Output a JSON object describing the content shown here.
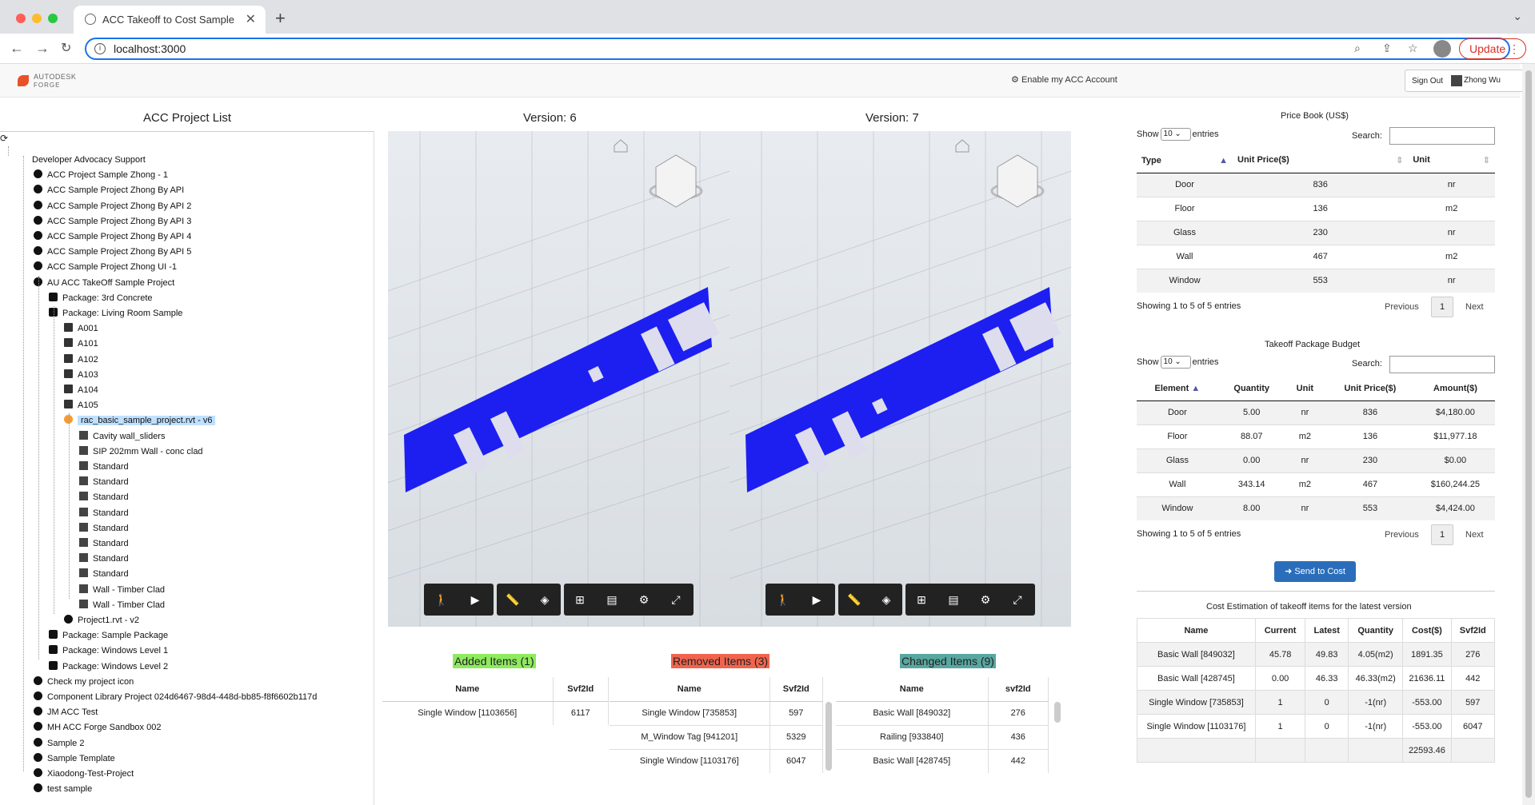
{
  "browser": {
    "tab_title": "ACC Takeoff to Cost Sample",
    "url": "localhost:3000",
    "update_label": "Update"
  },
  "header": {
    "logo_line1": "AUTODESK",
    "logo_line2": "FORGE",
    "enable_link": "Enable my ACC Account",
    "signout": "Sign Out",
    "user": "Zhong Wu"
  },
  "project_list": {
    "title": "ACC Project List",
    "items": [
      {
        "label": "Developer Advocacy Support",
        "level": 0,
        "icon": "none"
      },
      {
        "label": "ACC Project Sample Zhong - 1",
        "level": 1,
        "icon": "globe"
      },
      {
        "label": "ACC Sample Project Zhong By API",
        "level": 1,
        "icon": "globe"
      },
      {
        "label": "ACC Sample Project Zhong By API 2",
        "level": 1,
        "icon": "globe"
      },
      {
        "label": "ACC Sample Project Zhong By API 3",
        "level": 1,
        "icon": "globe"
      },
      {
        "label": "ACC Sample Project Zhong By API 4",
        "level": 1,
        "icon": "globe"
      },
      {
        "label": "ACC Sample Project Zhong By API 5",
        "level": 1,
        "icon": "globe"
      },
      {
        "label": "ACC Sample Project Zhong UI -1",
        "level": 1,
        "icon": "globe"
      },
      {
        "label": "AU ACC TakeOff Sample Project",
        "level": 1,
        "icon": "globe"
      },
      {
        "label": "Package: 3rd Concrete",
        "level": 2,
        "icon": "briefcase"
      },
      {
        "label": "Package: Living Room Sample",
        "level": 2,
        "icon": "briefcase"
      },
      {
        "label": "A001",
        "level": 3,
        "icon": "file"
      },
      {
        "label": "A101",
        "level": 3,
        "icon": "file"
      },
      {
        "label": "A102",
        "level": 3,
        "icon": "file"
      },
      {
        "label": "A103",
        "level": 3,
        "icon": "file"
      },
      {
        "label": "A104",
        "level": 3,
        "icon": "file"
      },
      {
        "label": "A105",
        "level": 3,
        "icon": "file"
      },
      {
        "label": "rac_basic_sample_project.rvt - v6",
        "level": 3,
        "icon": "rvt",
        "selected": true
      },
      {
        "label": "Cavity wall_sliders",
        "level": 4,
        "icon": "list"
      },
      {
        "label": "SIP 202mm Wall - conc clad",
        "level": 4,
        "icon": "list"
      },
      {
        "label": "Standard",
        "level": 4,
        "icon": "list"
      },
      {
        "label": "Standard",
        "level": 4,
        "icon": "list"
      },
      {
        "label": "Standard",
        "level": 4,
        "icon": "list"
      },
      {
        "label": "Standard",
        "level": 4,
        "icon": "list"
      },
      {
        "label": "Standard",
        "level": 4,
        "icon": "list"
      },
      {
        "label": "Standard",
        "level": 4,
        "icon": "list"
      },
      {
        "label": "Standard",
        "level": 4,
        "icon": "list"
      },
      {
        "label": "Standard",
        "level": 4,
        "icon": "list"
      },
      {
        "label": "Wall - Timber Clad",
        "level": 4,
        "icon": "list"
      },
      {
        "label": "Wall - Timber Clad",
        "level": 4,
        "icon": "list"
      },
      {
        "label": "Project1.rvt - v2",
        "level": 3,
        "icon": "gear"
      },
      {
        "label": "Package: Sample Package",
        "level": 2,
        "icon": "briefcase"
      },
      {
        "label": "Package: Windows Level 1",
        "level": 2,
        "icon": "briefcase"
      },
      {
        "label": "Package: Windows Level 2",
        "level": 2,
        "icon": "briefcase"
      },
      {
        "label": "Check my project icon",
        "level": 1,
        "icon": "globe"
      },
      {
        "label": "Component Library Project 024d6467-98d4-448d-bb85-f8f6602b117d",
        "level": 1,
        "icon": "globe"
      },
      {
        "label": "JM ACC Test",
        "level": 1,
        "icon": "globe"
      },
      {
        "label": "MH ACC Forge Sandbox 002",
        "level": 1,
        "icon": "globe"
      },
      {
        "label": "Sample 2",
        "level": 1,
        "icon": "globe"
      },
      {
        "label": "Sample Template",
        "level": 1,
        "icon": "globe"
      },
      {
        "label": "Xiaodong-Test-Project",
        "level": 1,
        "icon": "globe"
      },
      {
        "label": "test sample",
        "level": 1,
        "icon": "globe"
      }
    ]
  },
  "viewers": {
    "v1_title": "Version: 6",
    "v2_title": "Version: 7",
    "toolbar": [
      "walk-icon",
      "camera-icon",
      "measure-icon",
      "section-icon",
      "model-browser-icon",
      "properties-icon",
      "settings-icon",
      "fullscreen-icon"
    ]
  },
  "diff": {
    "added": {
      "title": "Added Items (1)",
      "headers": [
        "Name",
        "Svf2Id"
      ],
      "rows": [
        [
          "Single Window [1103656]",
          "6117"
        ]
      ]
    },
    "removed": {
      "title": "Removed Items (3)",
      "headers": [
        "Name",
        "Svf2Id"
      ],
      "rows": [
        [
          "Single Window [735853]",
          "597"
        ],
        [
          "M_Window Tag [941201]",
          "5329"
        ],
        [
          "Single Window [1103176]",
          "6047"
        ]
      ]
    },
    "changed": {
      "title": "Changed Items (9)",
      "headers": [
        "Name",
        "svf2Id"
      ],
      "rows": [
        [
          "Basic Wall [849032]",
          "276"
        ],
        [
          "Railing [933840]",
          "436"
        ],
        [
          "Basic Wall [428745]",
          "442"
        ]
      ]
    }
  },
  "price_book": {
    "title": "Price Book (US$)",
    "show": "Show",
    "entries_val": "10",
    "entries": "entries",
    "search": "Search:",
    "headers": [
      "Type",
      "Unit Price($)",
      "Unit"
    ],
    "rows": [
      [
        "Door",
        "836",
        "nr"
      ],
      [
        "Floor",
        "136",
        "m2"
      ],
      [
        "Glass",
        "230",
        "nr"
      ],
      [
        "Wall",
        "467",
        "m2"
      ],
      [
        "Window",
        "553",
        "nr"
      ]
    ],
    "info": "Showing 1 to 5 of 5 entries",
    "prev": "Previous",
    "page": "1",
    "next": "Next"
  },
  "budget": {
    "title": "Takeoff Package Budget",
    "show": "Show",
    "entries_val": "10",
    "entries": "entries",
    "search": "Search:",
    "headers": [
      "Element",
      "Quantity",
      "Unit",
      "Unit Price($)",
      "Amount($)"
    ],
    "rows": [
      [
        "Door",
        "5.00",
        "nr",
        "836",
        "$4,180.00"
      ],
      [
        "Floor",
        "88.07",
        "m2",
        "136",
        "$11,977.18"
      ],
      [
        "Glass",
        "0.00",
        "nr",
        "230",
        "$0.00"
      ],
      [
        "Wall",
        "343.14",
        "m2",
        "467",
        "$160,244.25"
      ],
      [
        "Window",
        "8.00",
        "nr",
        "553",
        "$4,424.00"
      ]
    ],
    "info": "Showing 1 to 5 of 5 entries",
    "prev": "Previous",
    "page": "1",
    "next": "Next",
    "send": "Send to Cost"
  },
  "cost_estimation": {
    "title": "Cost Estimation of takeoff items for the latest version",
    "headers": [
      "Name",
      "Current",
      "Latest",
      "Quantity",
      "Cost($)",
      "Svf2Id"
    ],
    "rows": [
      [
        "Basic Wall [849032]",
        "45.78",
        "49.83",
        "4.05(m2)",
        "1891.35",
        "276"
      ],
      [
        "Basic Wall [428745]",
        "0.00",
        "46.33",
        "46.33(m2)",
        "21636.11",
        "442"
      ],
      [
        "Single Window [735853]",
        "1",
        "0",
        "-1(nr)",
        "-553.00",
        "597"
      ],
      [
        "Single Window [1103176]",
        "1",
        "0",
        "-1(nr)",
        "-553.00",
        "6047"
      ],
      [
        "",
        "",
        "",
        "",
        "22593.46",
        ""
      ]
    ]
  }
}
